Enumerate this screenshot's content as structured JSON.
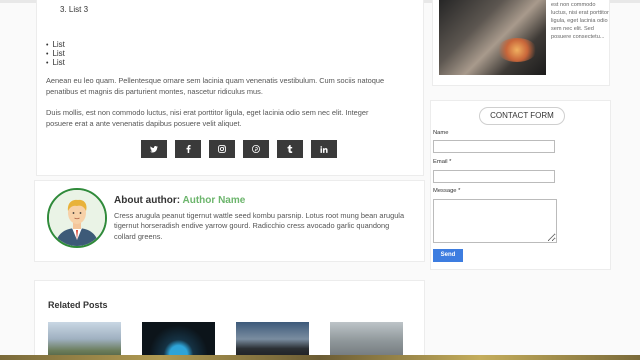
{
  "post": {
    "ordered_item": "3. List 3",
    "list_items": [
      "List",
      "List",
      "List"
    ],
    "paragraph1": "Aenean eu leo quam. Pellentesque ornare sem lacinia quam venenatis vestibulum. Cum sociis natoque penatibus et magnis dis parturient montes, nascetur ridiculus mus.",
    "paragraph2": "Duis mollis, est non commodo luctus, nisi erat porttitor ligula, eget lacinia odio sem nec elit. Integer posuere erat a ante venenatis dapibus posuere velit aliquet.",
    "share_icons": [
      "twitter-icon",
      "facebook-icon",
      "instagram-icon",
      "pinterest-icon",
      "tumblr-icon",
      "linkedin-icon"
    ]
  },
  "author": {
    "prefix": "About author: ",
    "name": "Author Name",
    "bio": "Cress arugula peanut tigernut wattle seed kombu parsnip. Lotus root mung bean arugula tigernut horseradish endive yarrow gourd. Radicchio cress avocado garlic quandong collard greens."
  },
  "related": {
    "title": "Related Posts"
  },
  "sidebar": {
    "snippet": "est non commodo luctus, nisi erat porttitor ligula, eget lacinia odio sem nec elit. Sed posuere consectetu..."
  },
  "contact_form": {
    "title": "CONTACT FORM",
    "name_label": "Name",
    "email_label": "Email *",
    "message_label": "Message *",
    "send_label": "Send"
  }
}
